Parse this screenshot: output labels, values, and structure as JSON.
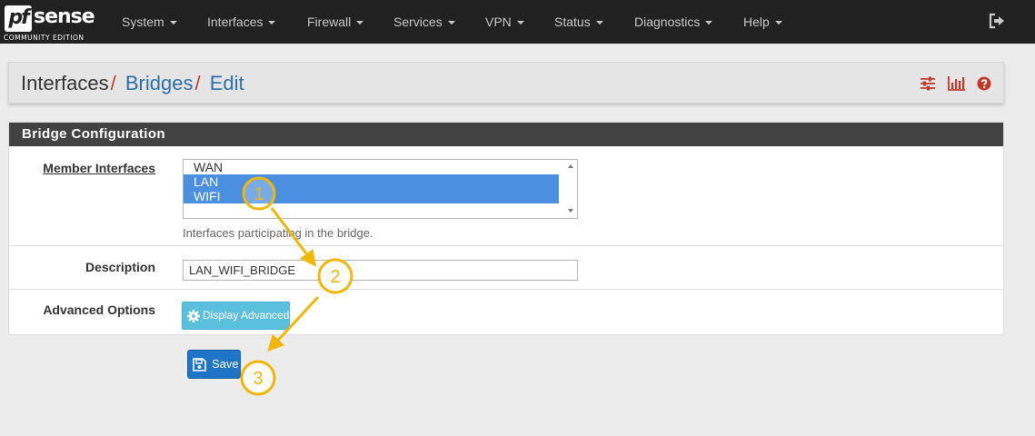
{
  "brand": {
    "logo_main": "pf",
    "logo_sub": "sense",
    "edition": "COMMUNITY EDITION"
  },
  "nav": {
    "items": [
      {
        "label": "System"
      },
      {
        "label": "Interfaces"
      },
      {
        "label": "Firewall"
      },
      {
        "label": "Services"
      },
      {
        "label": "VPN"
      },
      {
        "label": "Status"
      },
      {
        "label": "Diagnostics"
      },
      {
        "label": "Help"
      }
    ],
    "logout_icon": "sign-out-icon"
  },
  "breadcrumb": {
    "root": "Interfaces",
    "separator": "/",
    "middle": "Bridges",
    "current": "Edit",
    "icons": [
      "sliders-icon",
      "bar-chart-icon",
      "question-circle-icon"
    ]
  },
  "panel": {
    "title": "Bridge Configuration",
    "member_interfaces": {
      "label": "Member Interfaces",
      "options": [
        {
          "label": "WAN",
          "selected": false
        },
        {
          "label": "LAN",
          "selected": true
        },
        {
          "label": "WIFI",
          "selected": true
        }
      ],
      "help": "Interfaces participating in the bridge."
    },
    "description": {
      "label": "Description",
      "value": "LAN_WIFI_BRIDGE"
    },
    "advanced": {
      "label": "Advanced Options",
      "button": "Display Advanced",
      "icon": "gear-icon"
    }
  },
  "save": {
    "label": "Save",
    "icon": "floppy-disk-icon"
  },
  "annotations": {
    "markers": [
      "1",
      "2",
      "3"
    ],
    "color": "#f2b705"
  },
  "colors": {
    "navbar": "#212121",
    "panel_header": "#424242",
    "link": "#2d6fa8",
    "separator": "#c0392b",
    "info_button": "#5bc0de",
    "primary_button": "#1e74c7",
    "selected_option": "#4a8fe0"
  }
}
